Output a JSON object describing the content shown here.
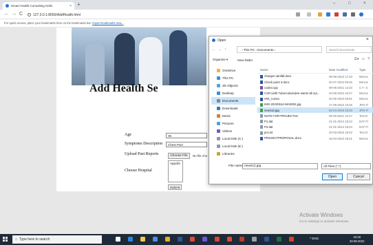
{
  "browser": {
    "tab_title": "Smart Health Consulting Onlin",
    "tab_close": "×",
    "new_tab": "+",
    "window_controls": [
      "–",
      "□",
      "×"
    ],
    "back": "←",
    "forward": "→",
    "reload": "C",
    "url": "127.0.0.1:8000/AddHealth.html",
    "bookmarks_text": "For quick access, place your bookmarks here on the bookmarks bar.",
    "bookmarks_link": "Import bookmarks now..."
  },
  "form": {
    "title": "Add Health Se",
    "age_label": "Age",
    "age_value": "35",
    "symptoms_label": "Symptoms Description",
    "symptoms_value": "Chest Pain",
    "upload_label": "Upload Past Reports",
    "choose_file": "Choose File",
    "no_file": "No file cho",
    "hospital_label": "Choose Hospital",
    "hospital_option": "Appollo",
    "submit": "Submit"
  },
  "dialog": {
    "title": "Open",
    "close": "×",
    "path": "› This PC  ›  Documents  ›",
    "search_placeholder": "Search Documents",
    "organize": "Organize ▾",
    "new_folder": "New folder",
    "nav_items": [
      {
        "label": "OneDrive",
        "icon": "cloud-icon",
        "color": "#f2b632"
      },
      {
        "label": "This PC",
        "icon": "pc-icon",
        "color": "#3a8fd6"
      },
      {
        "label": "3D Objects",
        "icon": "cube-icon",
        "color": "#4aa3df"
      },
      {
        "label": "Desktop",
        "icon": "desktop-icon",
        "color": "#3a8fd6"
      },
      {
        "label": "Documents",
        "icon": "documents-icon",
        "color": "#7d8a99"
      },
      {
        "label": "Downloads",
        "icon": "download-icon",
        "color": "#2f7ac0"
      },
      {
        "label": "Music",
        "icon": "music-icon",
        "color": "#e07b26"
      },
      {
        "label": "Pictures",
        "icon": "pictures-icon",
        "color": "#4aa3df"
      },
      {
        "label": "Videos",
        "icon": "video-icon",
        "color": "#6a5acd"
      },
      {
        "label": "Local Disk (C:)",
        "icon": "disk-icon",
        "color": "#8a99a8"
      },
      {
        "label": "Local Disk (E:)",
        "icon": "disk-icon",
        "color": "#8a99a8"
      },
      {
        "label": "Libraries",
        "icon": "library-icon",
        "color": "#c9a23a"
      }
    ],
    "columns": {
      "name": "Name",
      "date": "Date modified",
      "type": "Type"
    },
    "files": [
      {
        "name": "charges rainfall.docx",
        "date": "09-06-2022 17:23",
        "type": "Micros",
        "color": "#2b5797"
      },
      {
        "name": "Check point 3.docx",
        "date": "20-07-2022 09:46",
        "type": "Micros",
        "color": "#2b5797"
      },
      {
        "name": "code3.cpp",
        "date": "09-05-2021 14:23",
        "type": "C++ S",
        "color": "#7a4fa1"
      },
      {
        "name": "CXR (with Tuberculosis)He wants all out...",
        "date": "20-06-2022 15:47",
        "type": "Micros",
        "color": "#2b5797"
      },
      {
        "name": "HW_4.docx",
        "date": "20-06-2022 08:51",
        "type": "Micros",
        "color": "#2b5797"
      },
      {
        "name": "IMG-20220614-WA0002.jpg",
        "date": "17-06-2022 15:46",
        "type": "JPG Fi",
        "color": "#3fa04c"
      },
      {
        "name": "news12.jpg",
        "date": "02-04-2019 18:33",
        "type": "JPG Fi",
        "color": "#3fa04c"
      },
      {
        "name": "NOTE FOR PROJECT.txt",
        "date": "05-06-2021 12:17",
        "type": "Text D",
        "color": "#8a99a8"
      },
      {
        "name": "P1.dat",
        "date": "21-01-2014 15:24",
        "type": "DAT Fi",
        "color": "#8a99a8"
      },
      {
        "name": "P2.dat",
        "date": "21-01-2014 15:24",
        "type": "DAT Fi",
        "color": "#8a99a8"
      },
      {
        "name": "pcs.txt",
        "date": "20-03-2022 19:42",
        "type": "Text D",
        "color": "#8a99a8"
      },
      {
        "name": "PROJECTPROPOSAL.docx",
        "date": "15-04-2022 18:21",
        "type": "Micros",
        "color": "#2b5797"
      }
    ],
    "selected_index": 6,
    "file_name_label": "File name:",
    "file_name_value": "news12.jpg",
    "file_type": "All Files (*.*)",
    "open_button": "Open",
    "cancel_button": "Cancel"
  },
  "watermark": {
    "title": "Activate Windows",
    "subtitle": "Go to Settings to activate Windows."
  },
  "taskbar": {
    "search_placeholder": "Type here to search",
    "tray": "^  ENG",
    "time": "22:28",
    "date": "30-08-2022"
  }
}
